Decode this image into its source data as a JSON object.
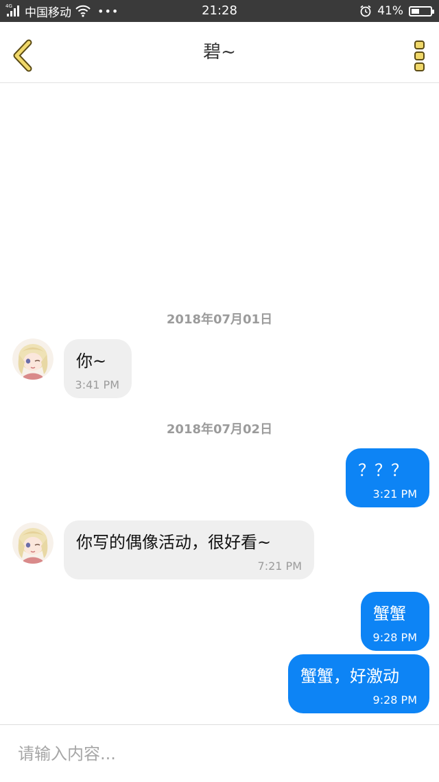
{
  "status_bar": {
    "network": "4G",
    "carrier": "中国移动",
    "time": "21:28",
    "battery": "41%",
    "battery_level": 0.41,
    "icons": [
      "signal-icon",
      "wifi-icon",
      "more-notifications-icon",
      "alarm-icon",
      "battery-icon"
    ]
  },
  "header": {
    "title": "碧~",
    "back_icon": "chevron-left-icon",
    "menu_icon": "more-vertical-icon"
  },
  "colors": {
    "accent_yellow": "#f0d86a",
    "outgoing_bubble": "#0d84f5",
    "incoming_bubble": "#efefef",
    "date_separator": "#9b9b9b"
  },
  "messages": {
    "date_1": "2018年07月01日",
    "date_2": "2018年07月02日",
    "m1": {
      "side": "incoming",
      "text": "你~",
      "time": "3:41 PM"
    },
    "m2": {
      "side": "outgoing",
      "text": "？？？",
      "time": "3:21 PM"
    },
    "m3": {
      "side": "incoming",
      "text": "你写的偶像活动，很好看~",
      "time": "7:21 PM"
    },
    "m4": {
      "side": "outgoing",
      "text": "蟹蟹",
      "time": "9:28 PM"
    },
    "m5": {
      "side": "outgoing",
      "text": "蟹蟹，好激动",
      "time": "9:28 PM"
    }
  },
  "input": {
    "placeholder": "请输入内容..."
  }
}
